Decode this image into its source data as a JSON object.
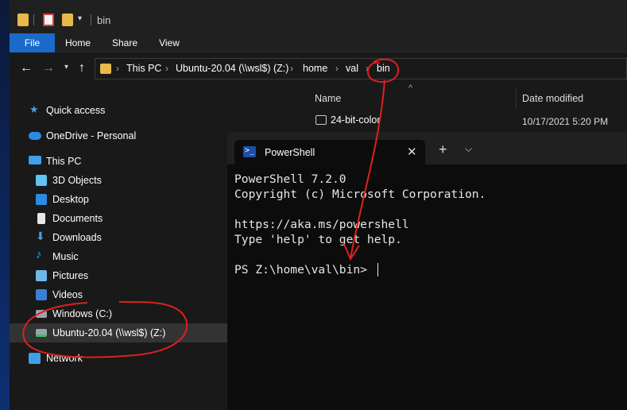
{
  "explorer": {
    "window_title": "bin",
    "qa_dropdown": "▾",
    "ribbon_tabs": [
      "File",
      "Home",
      "Share",
      "View"
    ],
    "nav_buttons": {
      "back": "←",
      "forward": "→",
      "recent": "▾",
      "up": "↑"
    },
    "breadcrumb": [
      "This PC",
      "Ubuntu-20.04 (\\\\wsl$) (Z:)",
      "home",
      "val",
      "bin"
    ],
    "chevron": "›",
    "nav_pane": [
      {
        "label": "Quick access",
        "icon": "star-icon"
      },
      {
        "label": "OneDrive - Personal",
        "icon": "cloud-icon"
      },
      {
        "label": "This PC",
        "icon": "computer-icon"
      },
      {
        "label": "3D Objects",
        "icon": "cube-icon"
      },
      {
        "label": "Desktop",
        "icon": "desktop-icon"
      },
      {
        "label": "Documents",
        "icon": "document-icon"
      },
      {
        "label": "Downloads",
        "icon": "download-icon"
      },
      {
        "label": "Music",
        "icon": "music-icon"
      },
      {
        "label": "Pictures",
        "icon": "pictures-icon"
      },
      {
        "label": "Videos",
        "icon": "videos-icon"
      },
      {
        "label": "Windows (C:)",
        "icon": "drive-icon"
      },
      {
        "label": "Ubuntu-20.04 (\\\\wsl$) (Z:)",
        "icon": "network-drive-icon"
      },
      {
        "label": "Network",
        "icon": "network-icon"
      }
    ],
    "file_list": {
      "columns": [
        "Name",
        "Date modified"
      ],
      "rows": [
        {
          "name": "24-bit-color",
          "date": "10/17/2021 5:20 PM"
        }
      ]
    }
  },
  "terminal": {
    "tab_label": "PowerShell",
    "close_glyph": "✕",
    "new_tab_glyph": "+",
    "dropdown_glyph": "⌵",
    "lines": [
      "PowerShell 7.2.0",
      "Copyright (c) Microsoft Corporation.",
      "",
      "https://aka.ms/powershell",
      "Type 'help' to get help.",
      "",
      "PS Z:\\home\\val\\bin> "
    ]
  },
  "colors": {
    "accent": "#1b6ac9",
    "annotation": "#e02020",
    "folder": "#e8b84a"
  }
}
